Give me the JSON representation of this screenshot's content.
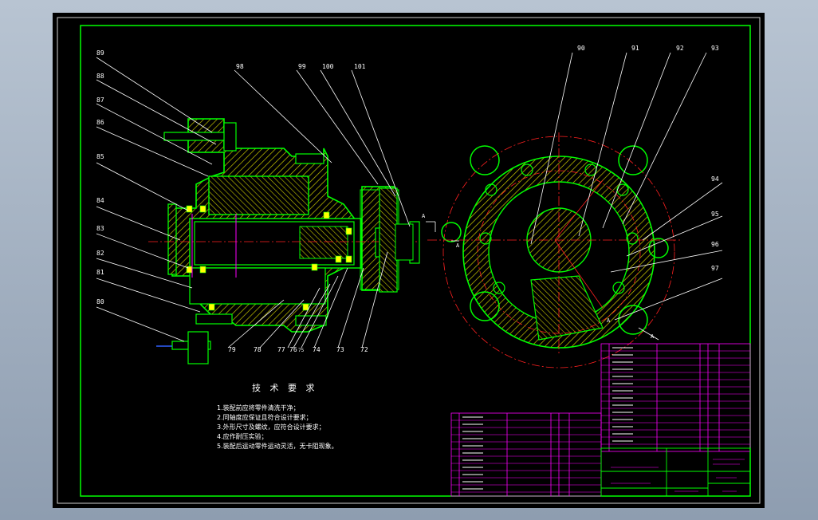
{
  "callouts_left": [
    "89",
    "88",
    "87",
    "86",
    "85",
    "84",
    "83",
    "82",
    "81",
    "80"
  ],
  "callouts_top": [
    "98",
    "99",
    "100",
    "101"
  ],
  "callouts_right": [
    "90",
    "91",
    "92",
    "93",
    "94",
    "95",
    "96",
    "97"
  ],
  "callouts_bottom": [
    "79",
    "78",
    "77",
    "76",
    "75",
    "74",
    "73",
    "72"
  ],
  "section_marks": [
    "A",
    "A",
    "A",
    "A"
  ],
  "tech_requirements": {
    "title": "技 术 要 求",
    "lines": [
      "1.装配前应将零件清洗干净；",
      "2.同轴度应保证且符合设计要求；",
      "3.外形尺寸及螺纹，应符合设计要求；",
      "4.应作耐压实验；",
      "5.装配后运动零件运动灵活，无卡阻现象。"
    ]
  },
  "colors": {
    "background": "#000000",
    "outline": "#00ff00",
    "hatch": "#ffff00",
    "centerline": "#ff2020",
    "leader": "#ffffff",
    "pin": "#ff00ff",
    "table": "#ff00ff",
    "frame": "#ffffff",
    "titleblock": "#00ff00"
  }
}
